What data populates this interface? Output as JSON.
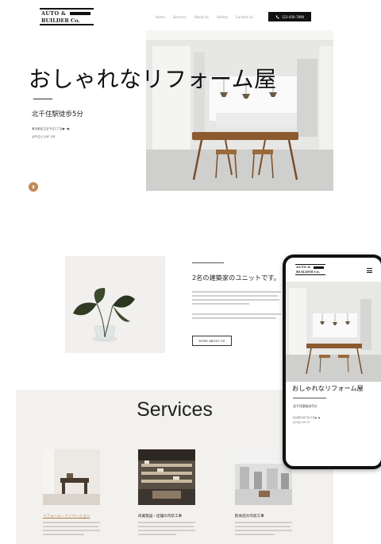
{
  "site": {
    "logo_line1": "AUTO &",
    "logo_line2": "BUILDER Co.",
    "nav": [
      "Home",
      "Services",
      "About Us",
      "Gallery",
      "Contact Us"
    ],
    "phone_label": "123-456-7890"
  },
  "hero": {
    "title": "おしゃれなリフォーム屋",
    "subtitle": "北千住駅徒歩5分",
    "address_line1": "東京都足立区千住1丁目●−●",
    "address_line2": "北千住ビル5F 1号"
  },
  "about": {
    "title": "2名の建築家のユニットです。",
    "more_button": "MORE ABOUT US"
  },
  "services": {
    "title": "Services",
    "items": [
      {
        "title": "リフォーム・リノベーション"
      },
      {
        "title": "商業施設・店舗の内装工事"
      },
      {
        "title": "飲食店の内装工事"
      }
    ]
  },
  "mobile": {
    "logo_line1": "AUTO &",
    "logo_line2": "BUILDER Co.",
    "title": "おしゃれなリフォーム屋",
    "subtitle": "北千住駅徒歩5分",
    "address_line1": "東京都足立区千住1丁目●−●",
    "address_line2": "北千住ビル5F 1号"
  },
  "colors": {
    "accent": "#c38a55",
    "services_bg": "#f3f1ee"
  }
}
